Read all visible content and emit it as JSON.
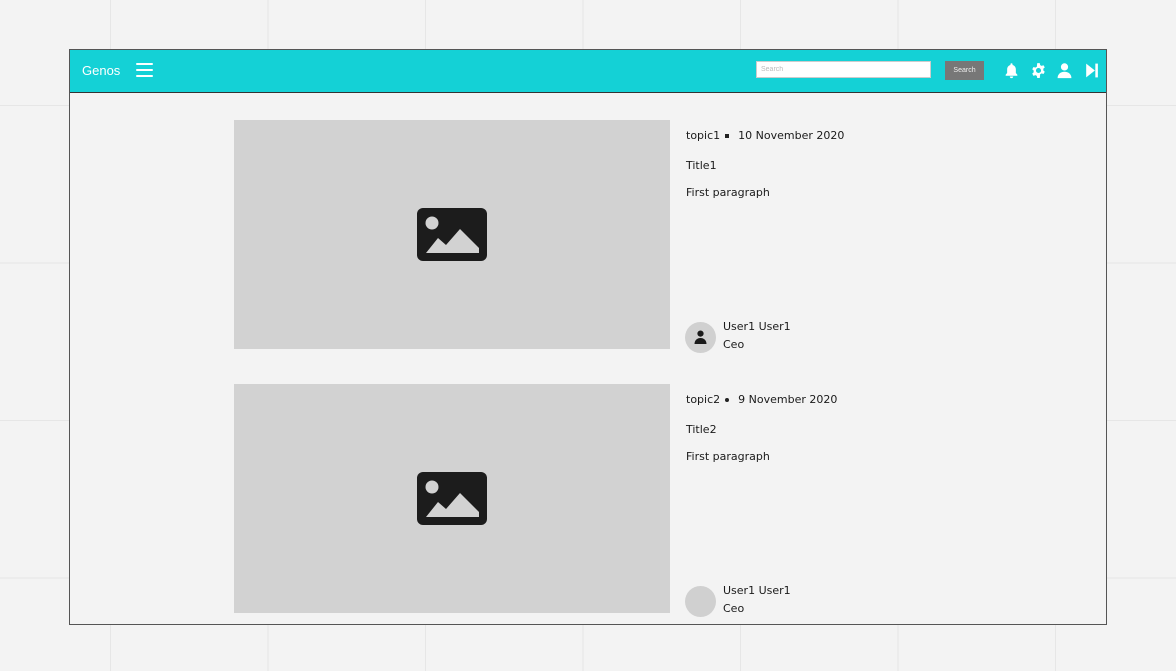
{
  "header": {
    "brand": "Genos",
    "search_placeholder": "Search",
    "search_button": "Search",
    "colors": {
      "bar": "#14d1d6"
    },
    "icons": [
      "menu-icon",
      "bell-icon",
      "gear-icon",
      "user-icon",
      "skip-forward-icon"
    ]
  },
  "articles": [
    {
      "topic": "topic1",
      "date": "10 November 2020",
      "title": "Title1",
      "paragraph": "First paragraph",
      "author": "User1 User1",
      "role": "Ceo",
      "image_icon": "image-placeholder-icon"
    },
    {
      "topic": "topic2",
      "date": "9 November 2020",
      "title": "Title2",
      "paragraph": "First paragraph",
      "author": "User1 User1",
      "role": "Ceo",
      "image_icon": "image-placeholder-icon"
    }
  ]
}
